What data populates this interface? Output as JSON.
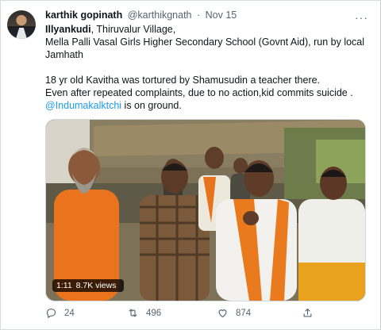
{
  "tweet": {
    "author_name": "karthik gopinath",
    "author_handle": "@karthikgnath",
    "separator": "·",
    "date": "Nov 15",
    "more": "···",
    "line1_bold": "Illyankudi",
    "line1_rest": ", Thiruvalur Village,",
    "line2": "Mella Palli Vasal Girls Higher Secondary School (Govnt Aid), run by local",
    "line3": "Jamhath",
    "line4": "18 yr old Kavitha was tortured by Shamusudin a teacher there.",
    "line5": "Even after repeated complaints, due to no action,kid commits suicide .",
    "mention": "@Indumakalktchi",
    "line6_rest": " is on ground."
  },
  "video": {
    "duration": "1:11",
    "views": "8.7K views"
  },
  "actions": {
    "replies": "24",
    "retweets": "496",
    "likes": "874"
  },
  "icons": [
    "reply-icon",
    "retweet-icon",
    "like-icon",
    "share-icon",
    "more-icon"
  ],
  "colors": {
    "link": "#1d9bf0",
    "secondary": "#536471",
    "text": "#0f1419"
  }
}
